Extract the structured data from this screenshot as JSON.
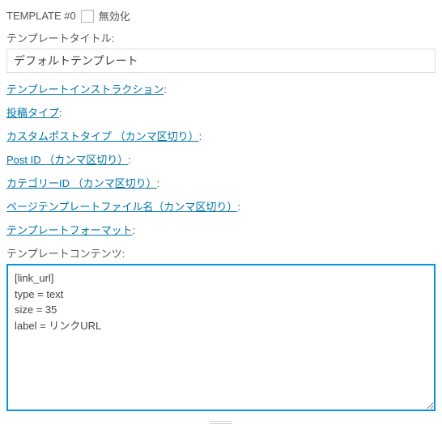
{
  "header": {
    "template_label": "TEMPLATE #0",
    "disable_label": "無効化"
  },
  "title": {
    "label": "テンプレートタイトル:",
    "value": "デフォルトテンプレート"
  },
  "links": {
    "instruction": "テンプレートインストラクション",
    "post_type": "投稿タイプ",
    "custom_post_type": "カスタムポストタイプ （カンマ区切り）",
    "post_id": "Post ID （カンマ区切り）",
    "category_id": "カテゴリーID （カンマ区切り）",
    "page_template_file": "ページテンプレートファイル名（カンマ区切り）",
    "template_format": "テンプレートフォーマット"
  },
  "colon": ":",
  "content": {
    "label": "テンプレートコンテンツ:",
    "value": "[link_url]\ntype = text\nsize = 35\nlabel = リンクURL"
  }
}
